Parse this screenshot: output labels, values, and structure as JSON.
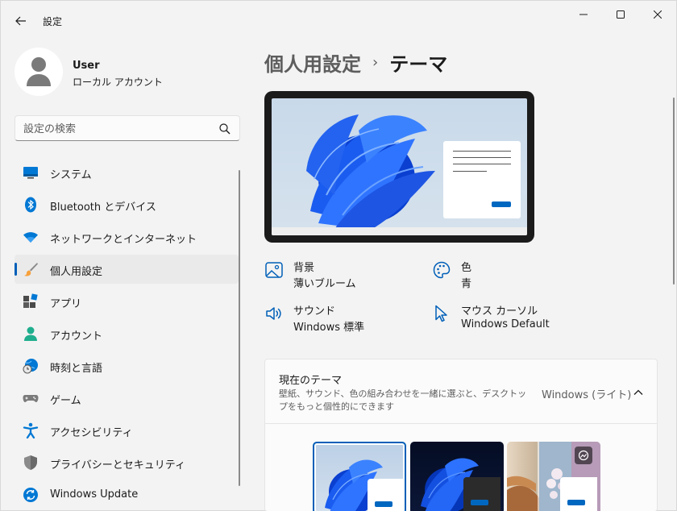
{
  "window": {
    "title": "設定"
  },
  "profile": {
    "name": "User",
    "account_type": "ローカル アカウント"
  },
  "search": {
    "placeholder": "設定の検索"
  },
  "sidebar": {
    "items": [
      {
        "label": "システム",
        "icon": "system-icon"
      },
      {
        "label": "Bluetooth とデバイス",
        "icon": "bluetooth-icon"
      },
      {
        "label": "ネットワークとインターネット",
        "icon": "wifi-icon"
      },
      {
        "label": "個人用設定",
        "icon": "brush-icon",
        "selected": true
      },
      {
        "label": "アプリ",
        "icon": "apps-icon"
      },
      {
        "label": "アカウント",
        "icon": "account-icon"
      },
      {
        "label": "時刻と言語",
        "icon": "globe-clock-icon"
      },
      {
        "label": "ゲーム",
        "icon": "gamepad-icon"
      },
      {
        "label": "アクセシビリティ",
        "icon": "accessibility-icon"
      },
      {
        "label": "プライバシーとセキュリティ",
        "icon": "shield-icon"
      },
      {
        "label": "Windows Update",
        "icon": "update-icon"
      }
    ]
  },
  "breadcrumb": {
    "parent": "個人用設定",
    "separator": "›",
    "current": "テーマ"
  },
  "properties": {
    "background": {
      "title": "背景",
      "value": "薄いブルーム"
    },
    "color": {
      "title": "色",
      "value": "青"
    },
    "sound": {
      "title": "サウンド",
      "value": "Windows 標準"
    },
    "cursor": {
      "title": "マウス カーソル",
      "value": "Windows Default"
    }
  },
  "current_theme": {
    "title": "現在のテーマ",
    "description": "壁紙、サウンド、色の組み合わせを一緒に選ぶと、デスクトップをもっと個性的にできます",
    "value": "Windows (ライト)"
  },
  "colors": {
    "accent": "#005fb8",
    "bloom_blue": "#1a5cf0",
    "window_bg": "#f3f3f3",
    "card_bg": "#fbfbfb"
  }
}
